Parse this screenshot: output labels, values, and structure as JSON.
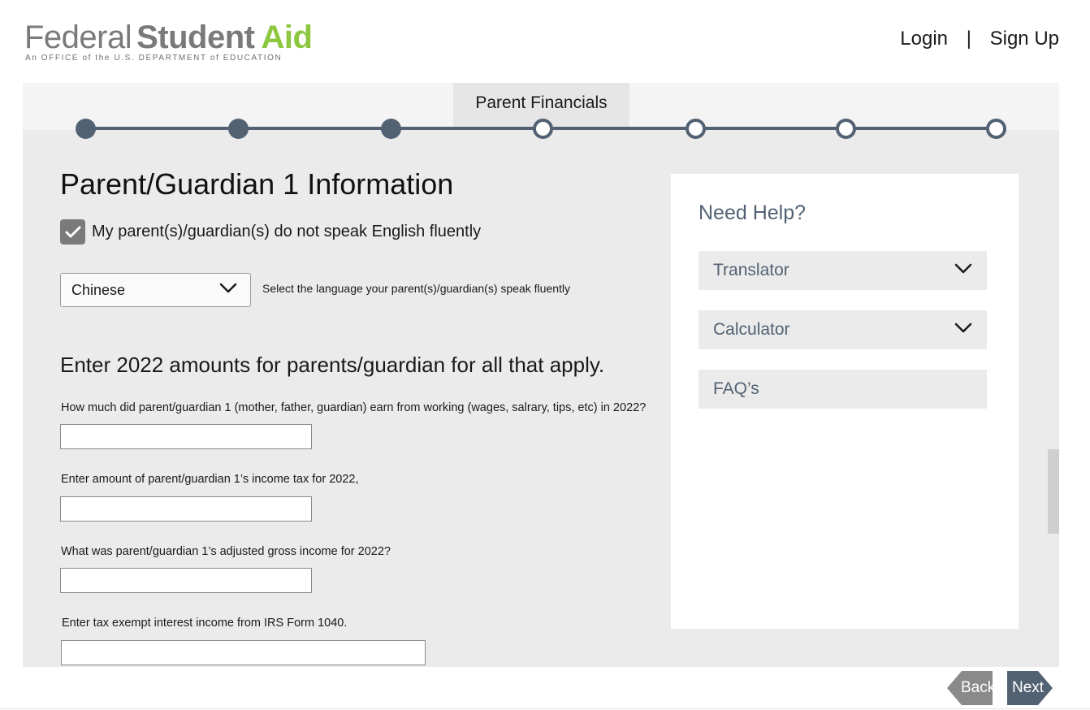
{
  "header": {
    "logo": {
      "word1": "Federal",
      "word2": "Student",
      "word3": "Aid",
      "tagline": "An OFFICE of the U.S. DEPARTMENT of EDUCATION"
    },
    "login_label": "Login",
    "separator": "|",
    "signup_label": "Sign Up"
  },
  "progress": {
    "current_step_label": "Parent Financials",
    "steps_total": 7,
    "steps_completed": 3
  },
  "form": {
    "title": "Parent/Guardian 1 Information",
    "not_fluent_checkbox": {
      "label": "My parent(s)/guardian(s) do not speak English fluently",
      "checked": true
    },
    "language_select": {
      "value": "Chinese",
      "hint": "Select the language your parent(s)/guardian(s) speak fluently"
    },
    "section_heading": "Enter 2022 amounts for parents/guardian for all that apply.",
    "questions": [
      {
        "label": "How much did parent/guardian 1 (mother, father, guardian) earn from working (wages, salrary, tips, etc) in  2022?",
        "value": ""
      },
      {
        "label": "Enter amount of parent/guardian 1’s income tax for 2022,",
        "value": ""
      },
      {
        "label": "What was parent/guardian 1’s adjusted gross income for 2022?",
        "value": ""
      },
      {
        "label": "Enter tax exempt interest income from IRS Form 1040.",
        "value": ""
      }
    ]
  },
  "help": {
    "title": "Need Help?",
    "items": [
      {
        "label": "Translator"
      },
      {
        "label": "Calculator"
      },
      {
        "label": "FAQ’s"
      }
    ]
  },
  "nav": {
    "back_label": "Back",
    "next_label": "Next"
  },
  "colors": {
    "accent": "#536273",
    "brand_green": "#8dc63f",
    "panel_bg": "#ebebeb",
    "back_button": "#8a8a8a"
  }
}
